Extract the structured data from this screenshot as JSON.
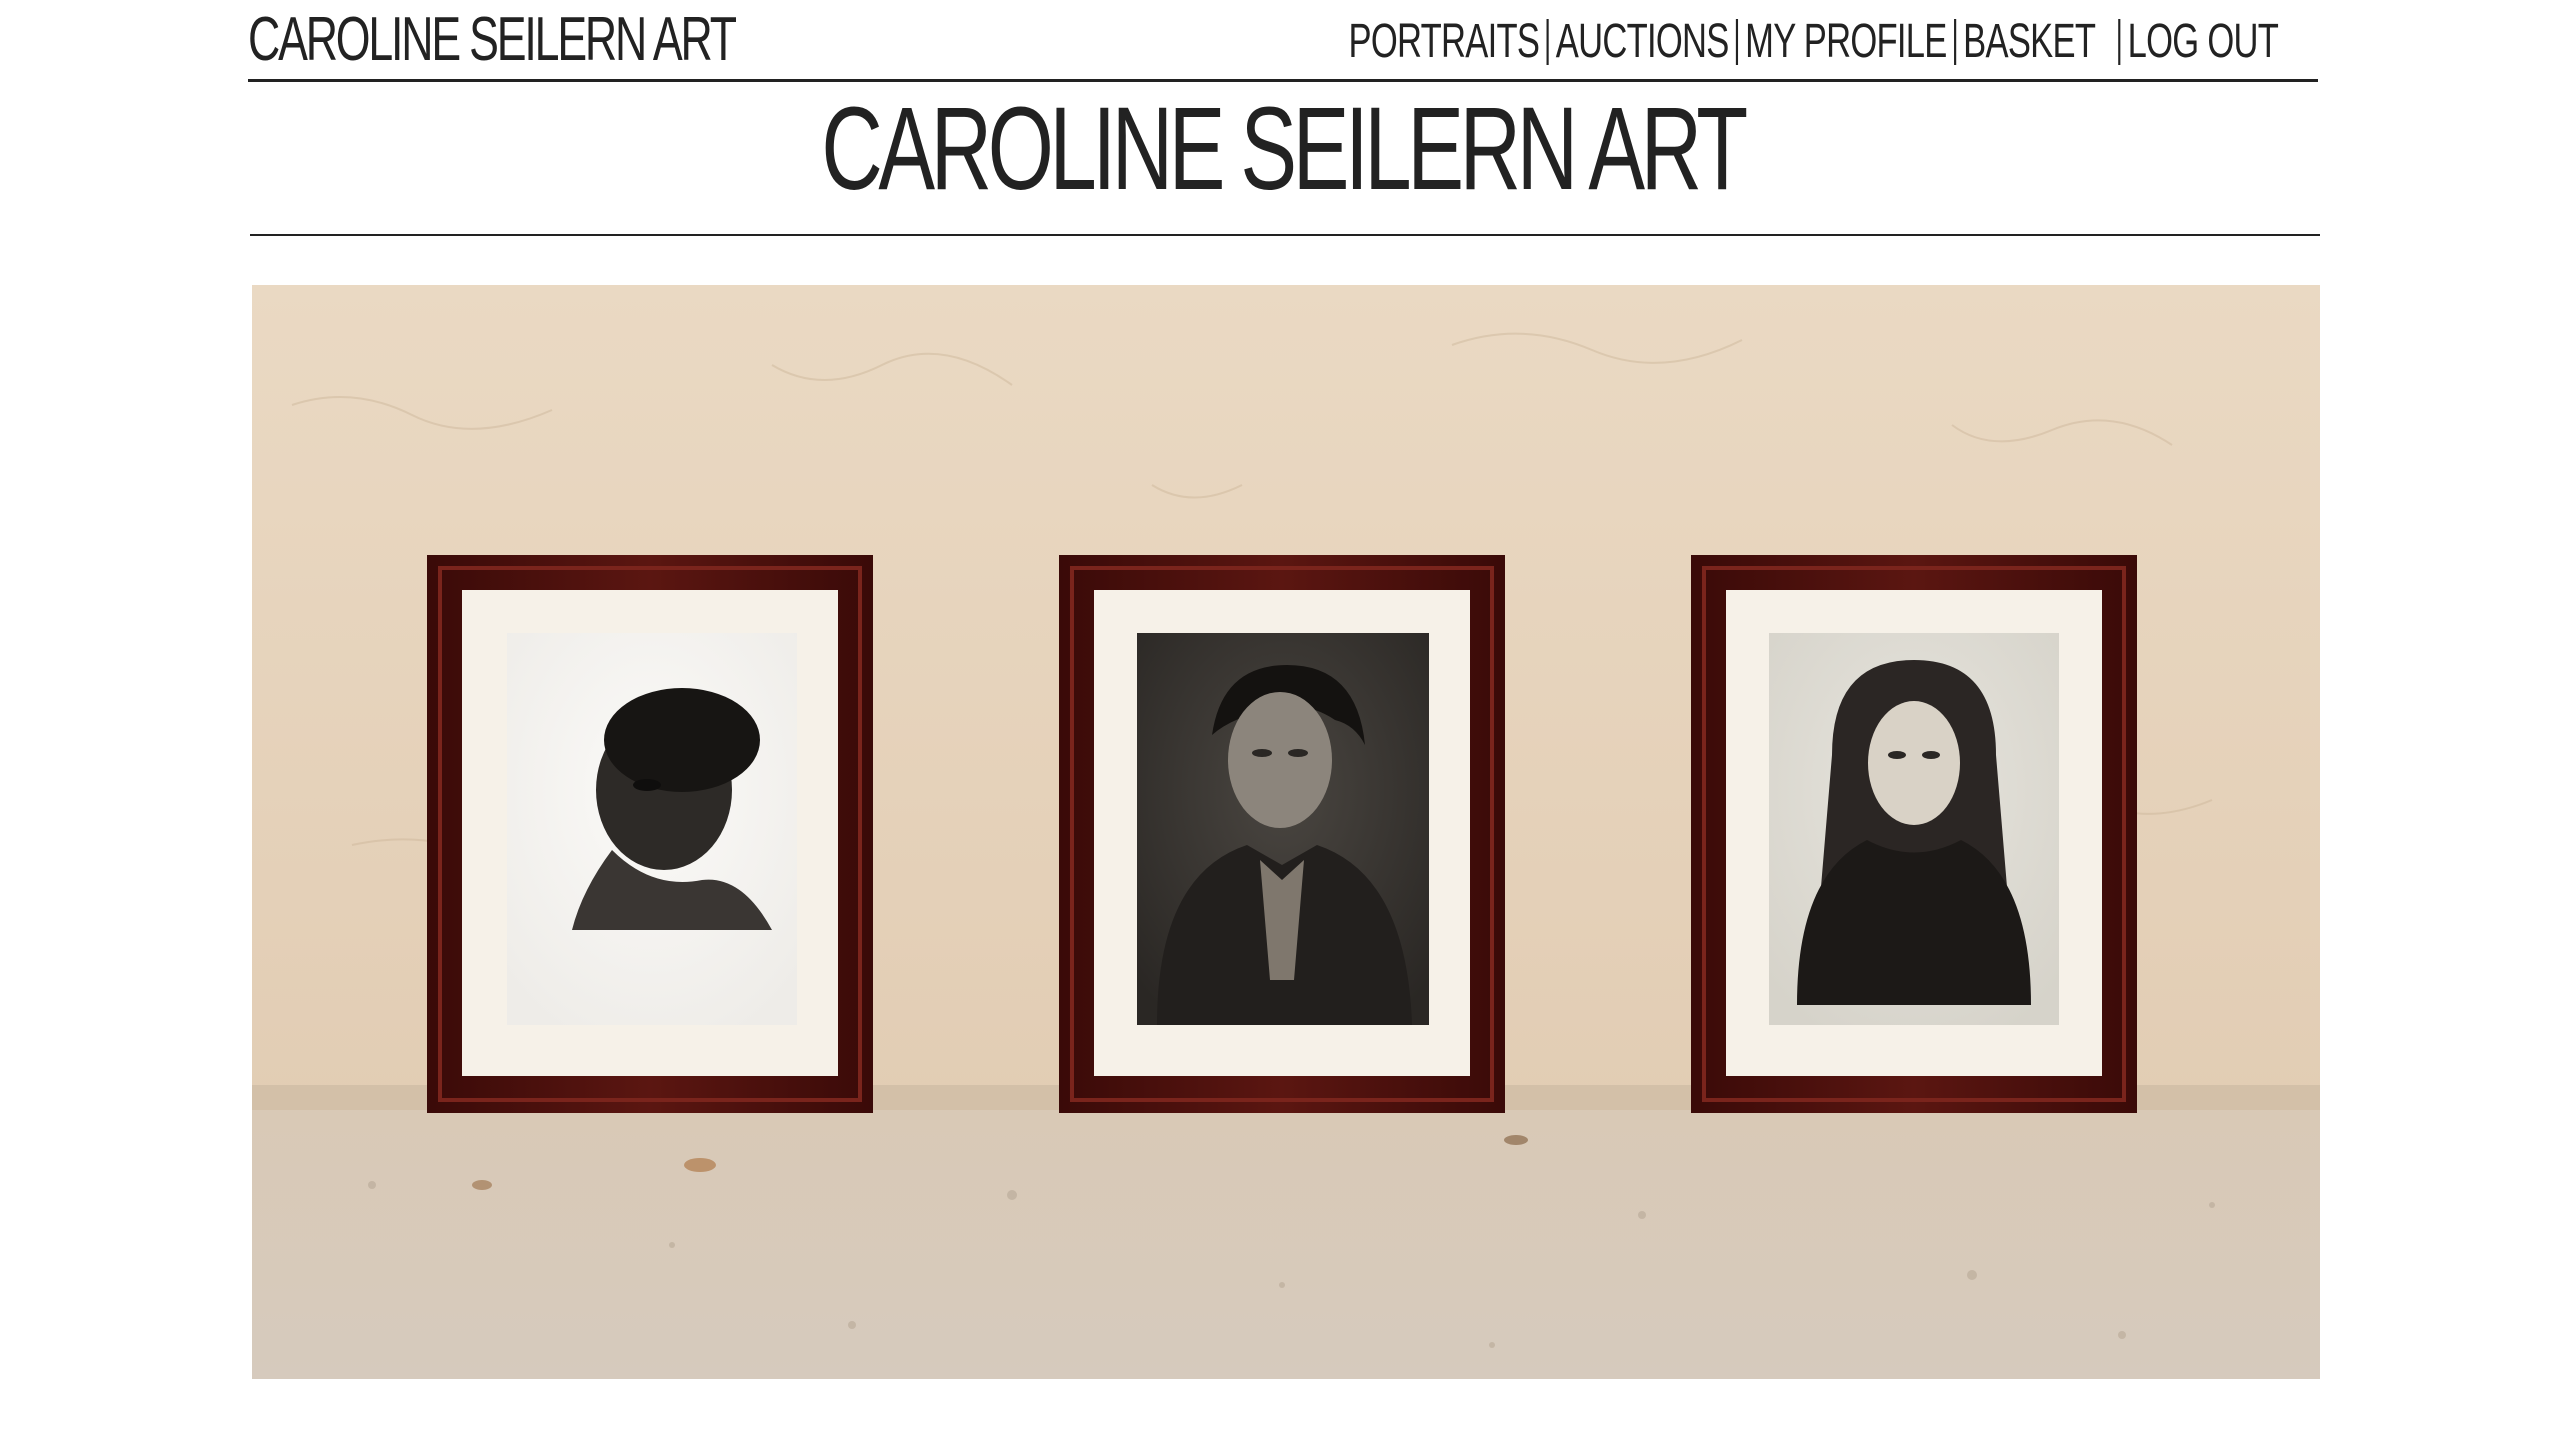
{
  "header": {
    "brand": "CAROLINE SEILERN ART",
    "nav": {
      "portraits": "PORTRAITS",
      "auctions": "AUCTIONS",
      "my_profile": "MY PROFILE",
      "basket": "BASKET",
      "log_out": "LOG OUT"
    }
  },
  "hero": {
    "title": "CAROLINE SEILERN ART",
    "image_alt": "Three framed charcoal portraits leaning against a sandstone wall"
  },
  "colors": {
    "text": "#222222",
    "background": "#ffffff",
    "wall": "#e6d3bb",
    "ground": "#d8cbbb",
    "frame": "#4a0f0c",
    "mat": "#f6f1e8"
  },
  "portraits": [
    {
      "icon": "portrait-man-profile"
    },
    {
      "icon": "portrait-man-jacket"
    },
    {
      "icon": "portrait-woman-long-hair"
    }
  ]
}
